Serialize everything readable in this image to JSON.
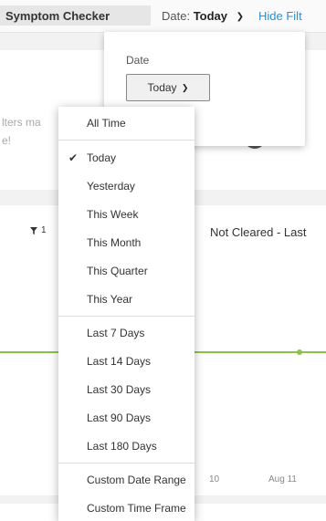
{
  "header": {
    "tab_label": "Symptom Checker",
    "date_prefix": "Date:",
    "date_value": "Today",
    "hide_filters_label": "Hide Filt"
  },
  "background": {
    "note_line1": "lters ma",
    "note_line2": "e!",
    "filter_count": "1",
    "card_title": "Not Cleared - Last",
    "x_labels": [
      "10",
      "Aug 11"
    ]
  },
  "date_popover": {
    "label": "Date",
    "selected": "Today"
  },
  "menu": {
    "items": [
      {
        "label": "All Time",
        "checked": false
      },
      {
        "label": "Today",
        "checked": true
      },
      {
        "label": "Yesterday",
        "checked": false
      },
      {
        "label": "This Week",
        "checked": false
      },
      {
        "label": "This Month",
        "checked": false
      },
      {
        "label": "This Quarter",
        "checked": false
      },
      {
        "label": "This Year",
        "checked": false
      },
      {
        "label": "Last 7 Days",
        "checked": false
      },
      {
        "label": "Last 14 Days",
        "checked": false
      },
      {
        "label": "Last 30 Days",
        "checked": false
      },
      {
        "label": "Last 90 Days",
        "checked": false
      },
      {
        "label": "Last 180 Days",
        "checked": false
      },
      {
        "label": "Custom Date Range",
        "checked": false
      },
      {
        "label": "Custom Time Frame",
        "checked": false
      }
    ]
  },
  "colors": {
    "link": "#2b8fd6",
    "series_line": "#8bc34a"
  }
}
